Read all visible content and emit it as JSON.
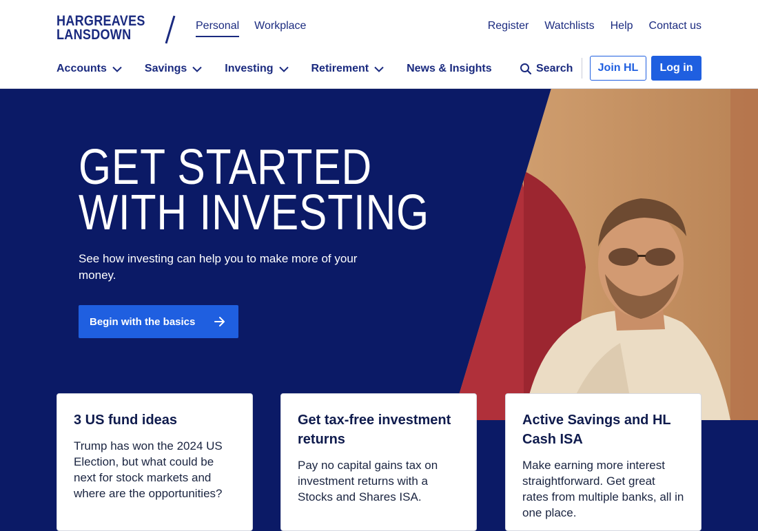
{
  "brand": {
    "logo_line1": "HARGREAVES",
    "logo_line2": "LANSDOWN",
    "primary_color": "#1a2a7f",
    "accent_color": "#1f5fe0",
    "hero_bg": "#0b1a66"
  },
  "top_nav": {
    "left": [
      "Personal",
      "Workplace"
    ],
    "active": "Personal",
    "right": [
      "Register",
      "Watchlists",
      "Help",
      "Contact us"
    ]
  },
  "main_nav": {
    "items": [
      {
        "label": "Accounts",
        "has_dropdown": true,
        "icon": "chevron-down-icon"
      },
      {
        "label": "Savings",
        "has_dropdown": true,
        "icon": "chevron-down-icon"
      },
      {
        "label": "Investing",
        "has_dropdown": true,
        "icon": "chevron-down-icon"
      },
      {
        "label": "Retirement",
        "has_dropdown": true,
        "icon": "chevron-down-icon"
      },
      {
        "label": "News & Insights",
        "has_dropdown": false
      }
    ],
    "search_label": "Search",
    "join_label": "Join HL",
    "login_label": "Log in"
  },
  "hero": {
    "title_line1": "GET STARTED",
    "title_line2": "WITH INVESTING",
    "subtitle": "See how investing can help you to make more of your money.",
    "cta_label": "Begin with the basics",
    "cta_icon": "arrow-right-icon"
  },
  "cards": [
    {
      "title": "3 US fund ideas",
      "body": "Trump has won the 2024 US Election, but what could be next for stock markets and where are the opportunities?"
    },
    {
      "title": "Get tax-free investment returns",
      "body": "Pay no capital gains tax on investment returns with a Stocks and Shares ISA."
    },
    {
      "title": "Active Savings and HL Cash ISA",
      "body": "Make earning more interest straightforward. Get great rates from multiple banks, all in one place."
    }
  ]
}
